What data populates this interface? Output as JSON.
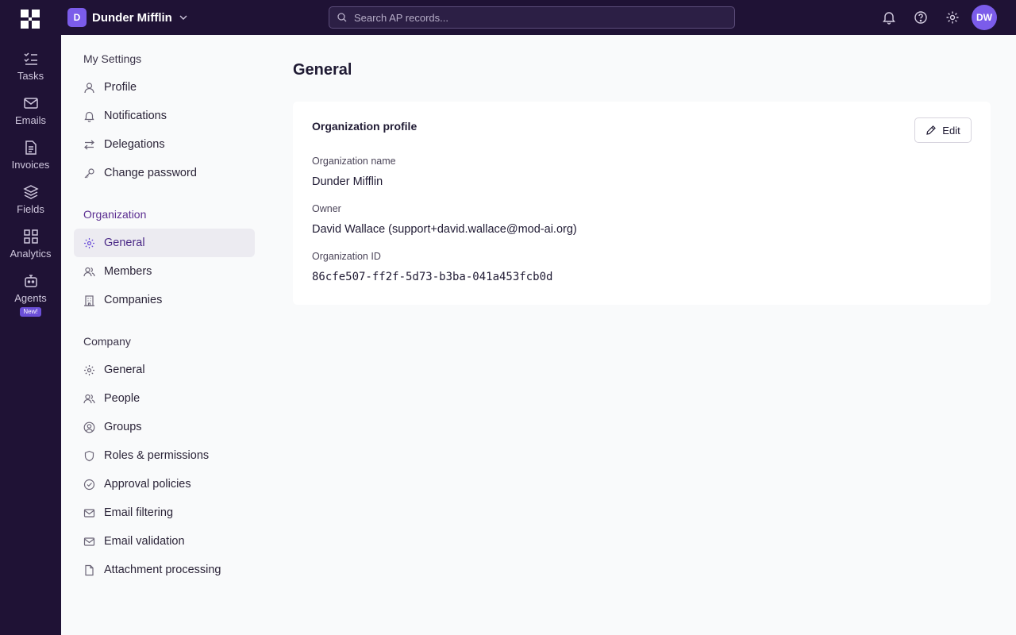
{
  "rail": {
    "items": [
      {
        "label": "Tasks",
        "icon": "tasks-icon"
      },
      {
        "label": "Emails",
        "icon": "mail-icon"
      },
      {
        "label": "Invoices",
        "icon": "document-icon"
      },
      {
        "label": "Fields",
        "icon": "layers-icon"
      },
      {
        "label": "Analytics",
        "icon": "grid-icon"
      },
      {
        "label": "Agents",
        "icon": "robot-icon",
        "badge": "New!"
      }
    ]
  },
  "topbar": {
    "org_initial": "D",
    "org_name": "Dunder Mifflin",
    "search_placeholder": "Search AP records...",
    "user_initials": "DW"
  },
  "nav": {
    "my_settings": {
      "heading": "My Settings",
      "items": [
        "Profile",
        "Notifications",
        "Delegations",
        "Change password"
      ]
    },
    "organization": {
      "heading": "Organization",
      "items": [
        "General",
        "Members",
        "Companies"
      ]
    },
    "company": {
      "heading": "Company",
      "items": [
        "General",
        "People",
        "Groups",
        "Roles & permissions",
        "Approval policies",
        "Email filtering",
        "Email validation",
        "Attachment processing"
      ]
    }
  },
  "main": {
    "title": "General",
    "card": {
      "title": "Organization profile",
      "edit_label": "Edit",
      "fields": [
        {
          "label": "Organization name",
          "value": "Dunder Mifflin"
        },
        {
          "label": "Owner",
          "value": "David Wallace (support+david.wallace@mod-ai.org)"
        },
        {
          "label": "Organization ID",
          "value": "86cfe507-ff2f-5d73-b3ba-041a453fcb0d"
        }
      ]
    }
  },
  "colors": {
    "rail_bg": "#1f1235",
    "accent": "#7b5cea",
    "org_heading": "#5b2e91",
    "active_item_bg": "#ecebf1"
  }
}
